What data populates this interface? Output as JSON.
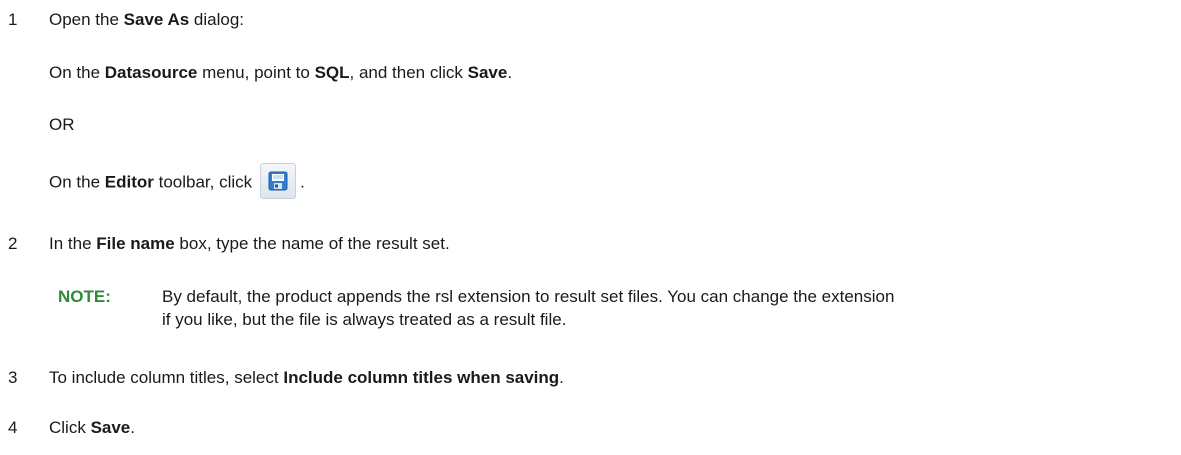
{
  "steps": [
    {
      "number": "1",
      "lines": {
        "l1_a": "Open the ",
        "l1_b": "Save As",
        "l1_c": " dialog:",
        "l2_a": "On the ",
        "l2_b": "Datasource",
        "l2_c": " menu, point to ",
        "l2_d": "SQL",
        "l2_e": ", and then click ",
        "l2_f": "Save",
        "l2_g": ".",
        "l3": "OR",
        "l4_a": "On the ",
        "l4_b": "Editor",
        "l4_c": " toolbar, click",
        "l4_d": "."
      }
    },
    {
      "number": "2",
      "lines": {
        "l1_a": "In the ",
        "l1_b": "File name",
        "l1_c": " box, type the name of the result set."
      }
    },
    {
      "number": "3",
      "lines": {
        "l1_a": "To include column titles, select ",
        "l1_b": "Include column titles when saving",
        "l1_c": "."
      }
    },
    {
      "number": "4",
      "lines": {
        "l1_a": "Click ",
        "l1_b": "Save",
        "l1_c": "."
      }
    }
  ],
  "note": {
    "label": "NOTE:",
    "line1": "By default, the product appends the rsl extension to result set files. You can change the extension",
    "line2": "if you like, but the file is always treated as a result file."
  },
  "icons": {
    "save": "save-floppy-icon"
  },
  "colors": {
    "note_label": "#2e8b3a",
    "icon_accent": "#2f7fd0"
  }
}
